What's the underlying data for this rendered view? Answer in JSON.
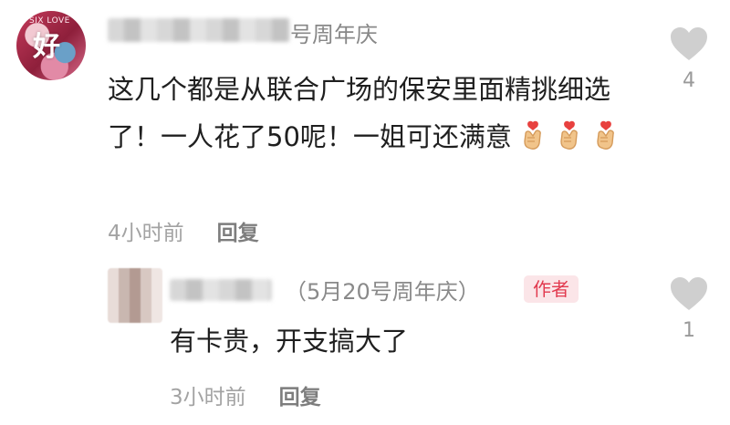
{
  "comments": [
    {
      "name_suffix": "号周年庆",
      "text": "这几个都是从联合广场的保安里面精挑细选了！一人花了50呢！一姐可还满意",
      "emojis": [
        "finger-heart-icon",
        "finger-heart-icon",
        "finger-heart-icon"
      ],
      "time": "4小时前",
      "reply_label": "回复",
      "likes": "4",
      "avatar_text": "好",
      "avatar_topline": "SIX LOVE"
    },
    {
      "name_suffix": "（5月20号周年庆）",
      "author_badge": "作者",
      "text": "有卡贵，开支搞大了",
      "time": "3小时前",
      "reply_label": "回复",
      "likes": "1"
    }
  ],
  "colors": {
    "badge_text": "#e23a4f",
    "badge_bg": "#fbe5e8",
    "heart_icon": "#cfcfcf",
    "emoji_hand": "#f1c48a",
    "emoji_heart": "#e8413f"
  }
}
